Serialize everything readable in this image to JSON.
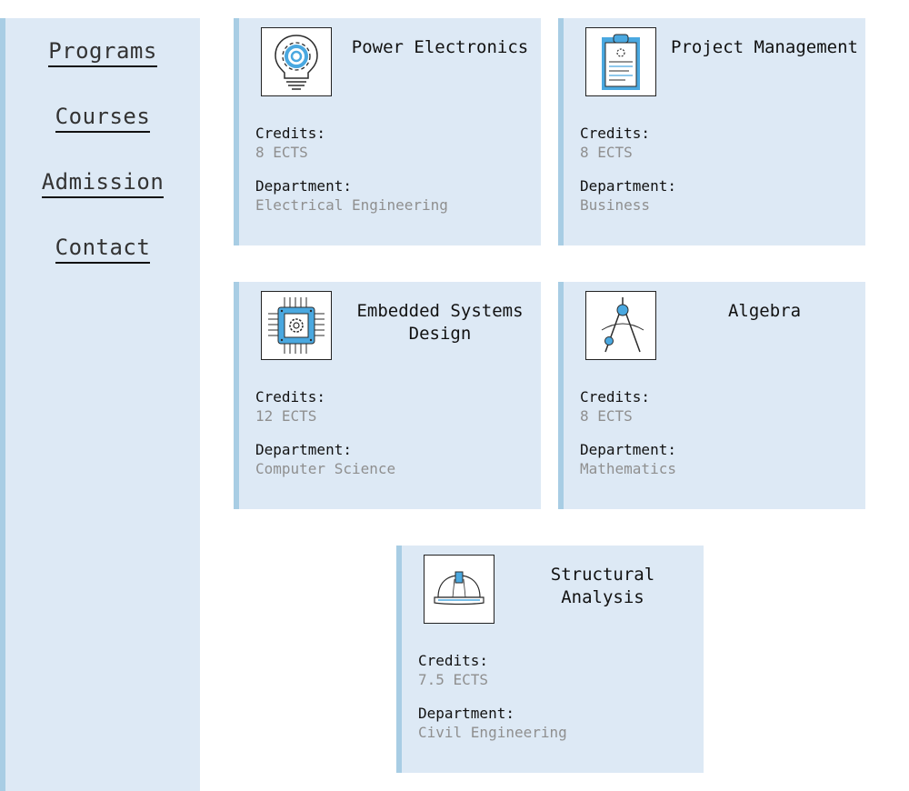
{
  "nav": {
    "items": [
      {
        "label": "Programs"
      },
      {
        "label": "Courses"
      },
      {
        "label": "Admission"
      },
      {
        "label": "Contact"
      }
    ]
  },
  "labels": {
    "credits": "Credits:",
    "department": "Department:"
  },
  "courses": [
    {
      "title": "Power Electronics",
      "credits": "8 ECTS",
      "department": "Electrical Engineering",
      "icon": "lightbulb-gear-icon"
    },
    {
      "title": "Project Management",
      "credits": "8 ECTS",
      "department": "Business",
      "icon": "clipboard-icon"
    },
    {
      "title": "Embedded Systems Design",
      "credits": "12 ECTS",
      "department": "Computer Science",
      "icon": "microchip-icon"
    },
    {
      "title": "Algebra",
      "credits": "8 ECTS",
      "department": "Mathematics",
      "icon": "compass-icon"
    },
    {
      "title": "Structural Analysis",
      "credits": "7.5 ECTS",
      "department": "Civil Engineering",
      "icon": "hard-hat-icon"
    }
  ],
  "colors": {
    "card_bg": "#dde9f5",
    "accent_border": "#a8cde4",
    "icon_blue": "#4aa8e0",
    "value_text": "#8f8f8f"
  }
}
